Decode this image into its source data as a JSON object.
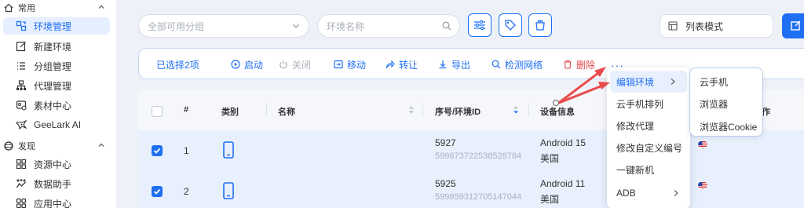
{
  "sidebar": {
    "section_common": "常用",
    "section_discover": "发现",
    "items": [
      {
        "label": "环境管理"
      },
      {
        "label": "新建环境"
      },
      {
        "label": "分组管理"
      },
      {
        "label": "代理管理"
      },
      {
        "label": "素材中心"
      },
      {
        "label": "GeeLark AI"
      },
      {
        "label": "资源中心"
      },
      {
        "label": "数据助手"
      },
      {
        "label": "应用中心"
      }
    ]
  },
  "toolbar": {
    "group_placeholder": "全部可用分组",
    "env_name_placeholder": "环境名称",
    "view_mode": "列表模式"
  },
  "action_bar": {
    "selected": "已选择2项",
    "start": "启动",
    "close": "关闭",
    "move": "移动",
    "transfer": "转让",
    "export": "导出",
    "check_network": "检测网络",
    "delete": "删除",
    "more": "···"
  },
  "table": {
    "headers": {
      "index": "#",
      "type": "类别",
      "name": "名称",
      "serial": "序号/环境ID",
      "device": "设备信息",
      "op_suffix": "作"
    },
    "rows": [
      {
        "index": "1",
        "serial": "5927",
        "env_id": "599873722538528784",
        "device": "Android 15",
        "region": "美国"
      },
      {
        "index": "2",
        "serial": "5925",
        "env_id": "599859312705147044",
        "device": "Android 11",
        "region": "美国"
      }
    ]
  },
  "menu": {
    "items": [
      {
        "label": "编辑环境"
      },
      {
        "label": "云手机排列"
      },
      {
        "label": "修改代理"
      },
      {
        "label": "修改自定义编号"
      },
      {
        "label": "一键新机"
      },
      {
        "label": "ADB"
      }
    ],
    "submenu": [
      {
        "label": "云手机"
      },
      {
        "label": "浏览器"
      },
      {
        "label": "浏览器Cookie"
      }
    ]
  },
  "colors": {
    "accent": "#1f6ff2",
    "danger": "#e5484d",
    "annotation": "#e94b4b",
    "selected_row": "#e8f0fe"
  }
}
